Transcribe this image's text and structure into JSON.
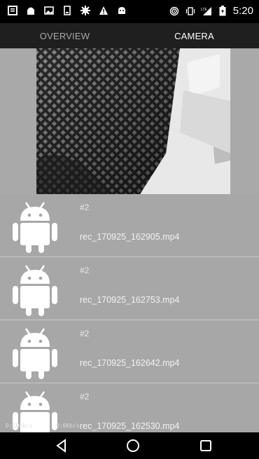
{
  "status_bar": {
    "left_icons": [
      "notes-icon",
      "shield-icon",
      "image-icon",
      "card-icon",
      "gear-icon",
      "warning-icon",
      "android-icon"
    ],
    "right_icons": [
      "hotspot-icon",
      "vibrate-icon",
      "lte-signal-icon",
      "battery-charging-icon"
    ],
    "time": "5:20"
  },
  "tabs": [
    {
      "label": "OVERVIEW",
      "selected": false
    },
    {
      "label": "CAMERA",
      "selected": true
    }
  ],
  "recordings": [
    {
      "number": "#2",
      "filename": "rec_170925_162905.mp4"
    },
    {
      "number": "#2",
      "filename": "rec_170925_162753.mp4"
    },
    {
      "number": "#2",
      "filename": "rec_170925_162642.mp4"
    },
    {
      "number": "#2",
      "filename": "rec_170925_162530.mp4"
    }
  ],
  "debug": {
    "download": "D:10Kb/s",
    "upload": "U:6Kb/s"
  },
  "nav_bar": {
    "buttons": [
      "back-icon",
      "home-icon",
      "recents-icon"
    ]
  },
  "colors": {
    "tab_bar": "#1f1f1f",
    "list_background": "#a7a7a7",
    "status_bar": "#000000"
  }
}
